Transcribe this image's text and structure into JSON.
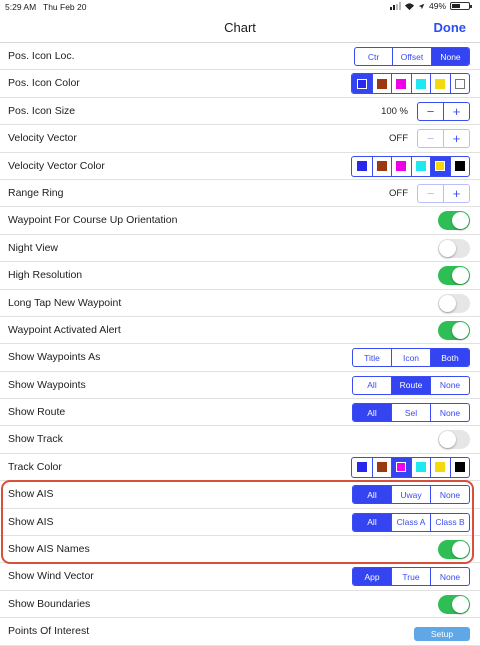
{
  "status": {
    "time": "5:29 AM",
    "day": "Thu Feb 20",
    "battery": "49%",
    "battery_level": 0.49
  },
  "nav": {
    "title": "Chart",
    "done": "Done"
  },
  "colors": {
    "accent": "#3344f0",
    "toggle_on": "#2fbe55",
    "highlight": "#d8503b",
    "setup": "#60a7e6"
  },
  "rows": [
    {
      "label": "Pos. Icon Loc.",
      "seg": [
        "Ctr",
        "Offset",
        "None"
      ],
      "selected": 2,
      "widths": [
        37,
        39,
        38
      ]
    },
    {
      "label": "Pos. Icon Color",
      "swatches": [
        "#2727ee",
        "#9b3a10",
        "#f000e8",
        "#1ee8f0",
        "#f4d90f",
        "#ffffff"
      ],
      "selected": 0
    },
    {
      "label": "Pos. Icon Size",
      "stepper_value": "100 %",
      "minus": "−",
      "plus": "+"
    },
    {
      "label": "Velocity Vector",
      "stepper_value": "OFF",
      "minus": "−",
      "plus": "+"
    },
    {
      "label": "Velocity Vector Color",
      "swatches": [
        "#2727ee",
        "#9b3a10",
        "#f000e8",
        "#1ee8f0",
        "#f4d90f",
        "#000000"
      ],
      "selected": 4
    },
    {
      "label": "Range Ring",
      "stepper_value": "OFF",
      "minus": "−",
      "plus": "+"
    },
    {
      "label": "Waypoint For Course Up Orientation",
      "toggle": true
    },
    {
      "label": "Night View",
      "toggle": false
    },
    {
      "label": "High Resolution",
      "toggle": true
    },
    {
      "label": "Long Tap New Waypoint",
      "toggle": false
    },
    {
      "label": "Waypoint Activated Alert",
      "toggle": true
    },
    {
      "label": "Show Waypoints As",
      "seg": [
        "Title",
        "Icon",
        "Both"
      ],
      "selected": 2,
      "widths": [
        38,
        39,
        39
      ]
    },
    {
      "label": "Show Waypoints",
      "seg": [
        "All",
        "Route",
        "None"
      ],
      "selected": 1,
      "widths": [
        38,
        39,
        39
      ]
    },
    {
      "label": "Show Route",
      "seg": [
        "All",
        "Sel",
        "None"
      ],
      "selected": 0,
      "widths": [
        38,
        39,
        39
      ]
    },
    {
      "label": "Show Track",
      "toggle": false
    },
    {
      "label": "Track Color",
      "swatches": [
        "#2727ee",
        "#9b3a10",
        "#f000e8",
        "#1ee8f0",
        "#f4d90f",
        "#000000"
      ],
      "selected": 2
    },
    {
      "label": "Show AIS",
      "seg": [
        "All",
        "Uway",
        "None"
      ],
      "selected": 0,
      "widths": [
        38,
        39,
        39
      ]
    },
    {
      "label": "Show AIS",
      "seg": [
        "All",
        "Class A",
        "Class B"
      ],
      "selected": 0,
      "widths": [
        38,
        39,
        39
      ]
    },
    {
      "label": "Show AIS Names",
      "toggle": true
    },
    {
      "label": "Show Wind Vector",
      "seg": [
        "App",
        "True",
        "None"
      ],
      "selected": 0,
      "widths": [
        38,
        39,
        39
      ]
    },
    {
      "label": "Show Boundaries",
      "toggle": true
    },
    {
      "label": "Points Of Interest",
      "button": "Setup"
    }
  ]
}
